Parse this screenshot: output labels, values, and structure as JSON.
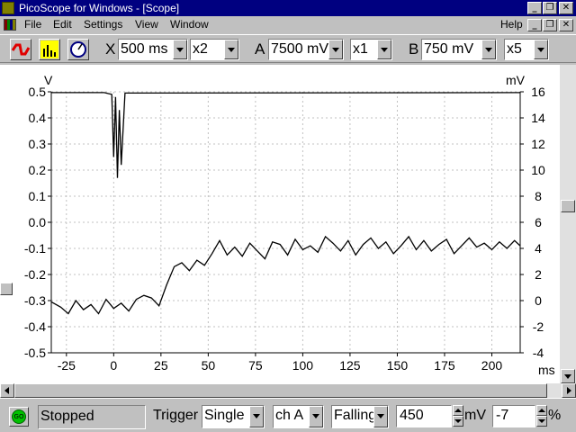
{
  "window": {
    "title": "PicoScope for Windows - [Scope]",
    "minimize_glyph": "_",
    "maximize_glyph": "❐",
    "close_glyph": "✕"
  },
  "menu": {
    "items": [
      "File",
      "Edit",
      "Settings",
      "View",
      "Window"
    ],
    "help": "Help"
  },
  "toolbar": {
    "buttons": [
      "scope-icon",
      "spectrum-icon",
      "meter-icon"
    ],
    "x_label": "X",
    "x_timebase": "500 ms",
    "x_multiplier": "x2",
    "a_label": "A",
    "a_range": "7500 mV",
    "a_multiplier": "x1",
    "b_label": "B",
    "b_range": "750 mV",
    "b_multiplier": "x5"
  },
  "scope": {
    "left_unit": "V",
    "right_unit": "mV",
    "x_unit": "ms",
    "left_ticks": [
      "0.5",
      "0.4",
      "0.3",
      "0.2",
      "0.1",
      "0.0",
      "-0.1",
      "-0.2",
      "-0.3",
      "-0.4",
      "-0.5"
    ],
    "right_ticks": [
      "16",
      "14",
      "12",
      "10",
      "8",
      "6",
      "4",
      "2",
      "0",
      "-2",
      "-4"
    ],
    "x_ticks": [
      "-25",
      "0",
      "25",
      "50",
      "75",
      "100",
      "125",
      "150",
      "175",
      "200"
    ],
    "trace_color": "#000000",
    "grid_color": "#c0c0c0"
  },
  "chart_data": {
    "type": "line",
    "xlabel": "ms",
    "ylabel": "V",
    "y2label": "mV",
    "xlim": [
      -33,
      215
    ],
    "ylim": [
      -0.5,
      0.5
    ],
    "y2lim": [
      -4,
      16
    ],
    "grid": true,
    "series": [
      {
        "axis": "left",
        "x": [
          -33,
          -5,
          -1,
          0,
          1,
          2,
          3,
          4,
          6,
          215
        ],
        "y": [
          0.497,
          0.497,
          0.49,
          0.25,
          0.48,
          0.17,
          0.43,
          0.22,
          0.495,
          0.497
        ]
      },
      {
        "axis": "right",
        "x": [
          -33,
          -28,
          -24,
          -20,
          -16,
          -12,
          -8,
          -4,
          0,
          4,
          8,
          12,
          16,
          20,
          24,
          28,
          32,
          36,
          40,
          44,
          48,
          52,
          56,
          60,
          64,
          68,
          72,
          76,
          80,
          84,
          88,
          92,
          96,
          100,
          104,
          108,
          112,
          116,
          120,
          124,
          128,
          132,
          136,
          140,
          144,
          148,
          152,
          156,
          160,
          164,
          168,
          172,
          176,
          180,
          184,
          188,
          192,
          196,
          200,
          204,
          208,
          212,
          215
        ],
        "y": [
          -0.1,
          -0.5,
          -1,
          0,
          -0.7,
          -0.3,
          -1,
          0.1,
          -0.6,
          -0.2,
          -0.8,
          0.1,
          0.4,
          0.2,
          -0.4,
          1.2,
          2.6,
          2.9,
          2.3,
          3.1,
          2.7,
          3.6,
          4.6,
          3.5,
          4.1,
          3.4,
          4.4,
          3.8,
          3.2,
          4.5,
          4.3,
          3.5,
          4.7,
          3.9,
          4.2,
          3.7,
          4.9,
          4.4,
          3.8,
          4.6,
          3.5,
          4.3,
          4.8,
          4.0,
          4.5,
          3.6,
          4.2,
          4.9,
          3.9,
          4.6,
          3.8,
          4.3,
          4.7,
          3.6,
          4.2,
          4.8,
          4.1,
          4.4,
          3.9,
          4.5,
          4.0,
          4.6,
          4.2
        ]
      }
    ]
  },
  "status": {
    "go_label": "GO",
    "state": "Stopped",
    "trigger_label": "Trigger",
    "trigger_mode": "Single",
    "trigger_channel": "ch A",
    "trigger_edge": "Falling",
    "trigger_level": "450",
    "level_unit": "mV",
    "delay": "-7",
    "delay_unit": "%"
  }
}
